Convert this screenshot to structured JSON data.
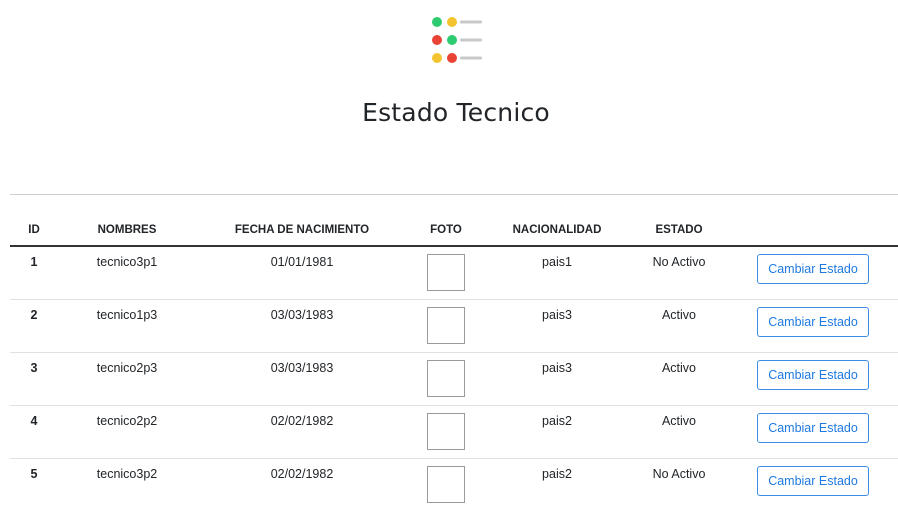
{
  "page": {
    "title": "Estado Tecnico"
  },
  "logo": {
    "icon": "status-list-icon",
    "dots": [
      [
        "#2ecc71",
        "#f4c430"
      ],
      [
        "#ea4335",
        "#2ecc71"
      ],
      [
        "#f4c430",
        "#ea4335"
      ]
    ],
    "line_color": "#c8c8c8"
  },
  "table": {
    "headers": {
      "id": "ID",
      "nombres": "NOMBRES",
      "fecha": "FECHA DE NACIMIENTO",
      "foto": "FOTO",
      "nacionalidad": "NACIONALIDAD",
      "estado": "ESTADO",
      "accion": ""
    },
    "rows": [
      {
        "id": "1",
        "nombres": "tecnico3p1",
        "fecha": "01/01/1981",
        "nacionalidad": "pais1",
        "estado": "No Activo",
        "accion": "Cambiar Estado"
      },
      {
        "id": "2",
        "nombres": "tecnico1p3",
        "fecha": "03/03/1983",
        "nacionalidad": "pais3",
        "estado": "Activo",
        "accion": "Cambiar Estado"
      },
      {
        "id": "3",
        "nombres": "tecnico2p3",
        "fecha": "03/03/1983",
        "nacionalidad": "pais3",
        "estado": "Activo",
        "accion": "Cambiar Estado"
      },
      {
        "id": "4",
        "nombres": "tecnico2p2",
        "fecha": "02/02/1982",
        "nacionalidad": "pais2",
        "estado": "Activo",
        "accion": "Cambiar Estado"
      },
      {
        "id": "5",
        "nombres": "tecnico3p2",
        "fecha": "02/02/1982",
        "nacionalidad": "pais2",
        "estado": "No Activo",
        "accion": "Cambiar Estado"
      }
    ]
  },
  "colors": {
    "accent": "#1f7ae0",
    "text": "#212529",
    "border": "#dee2e6"
  }
}
